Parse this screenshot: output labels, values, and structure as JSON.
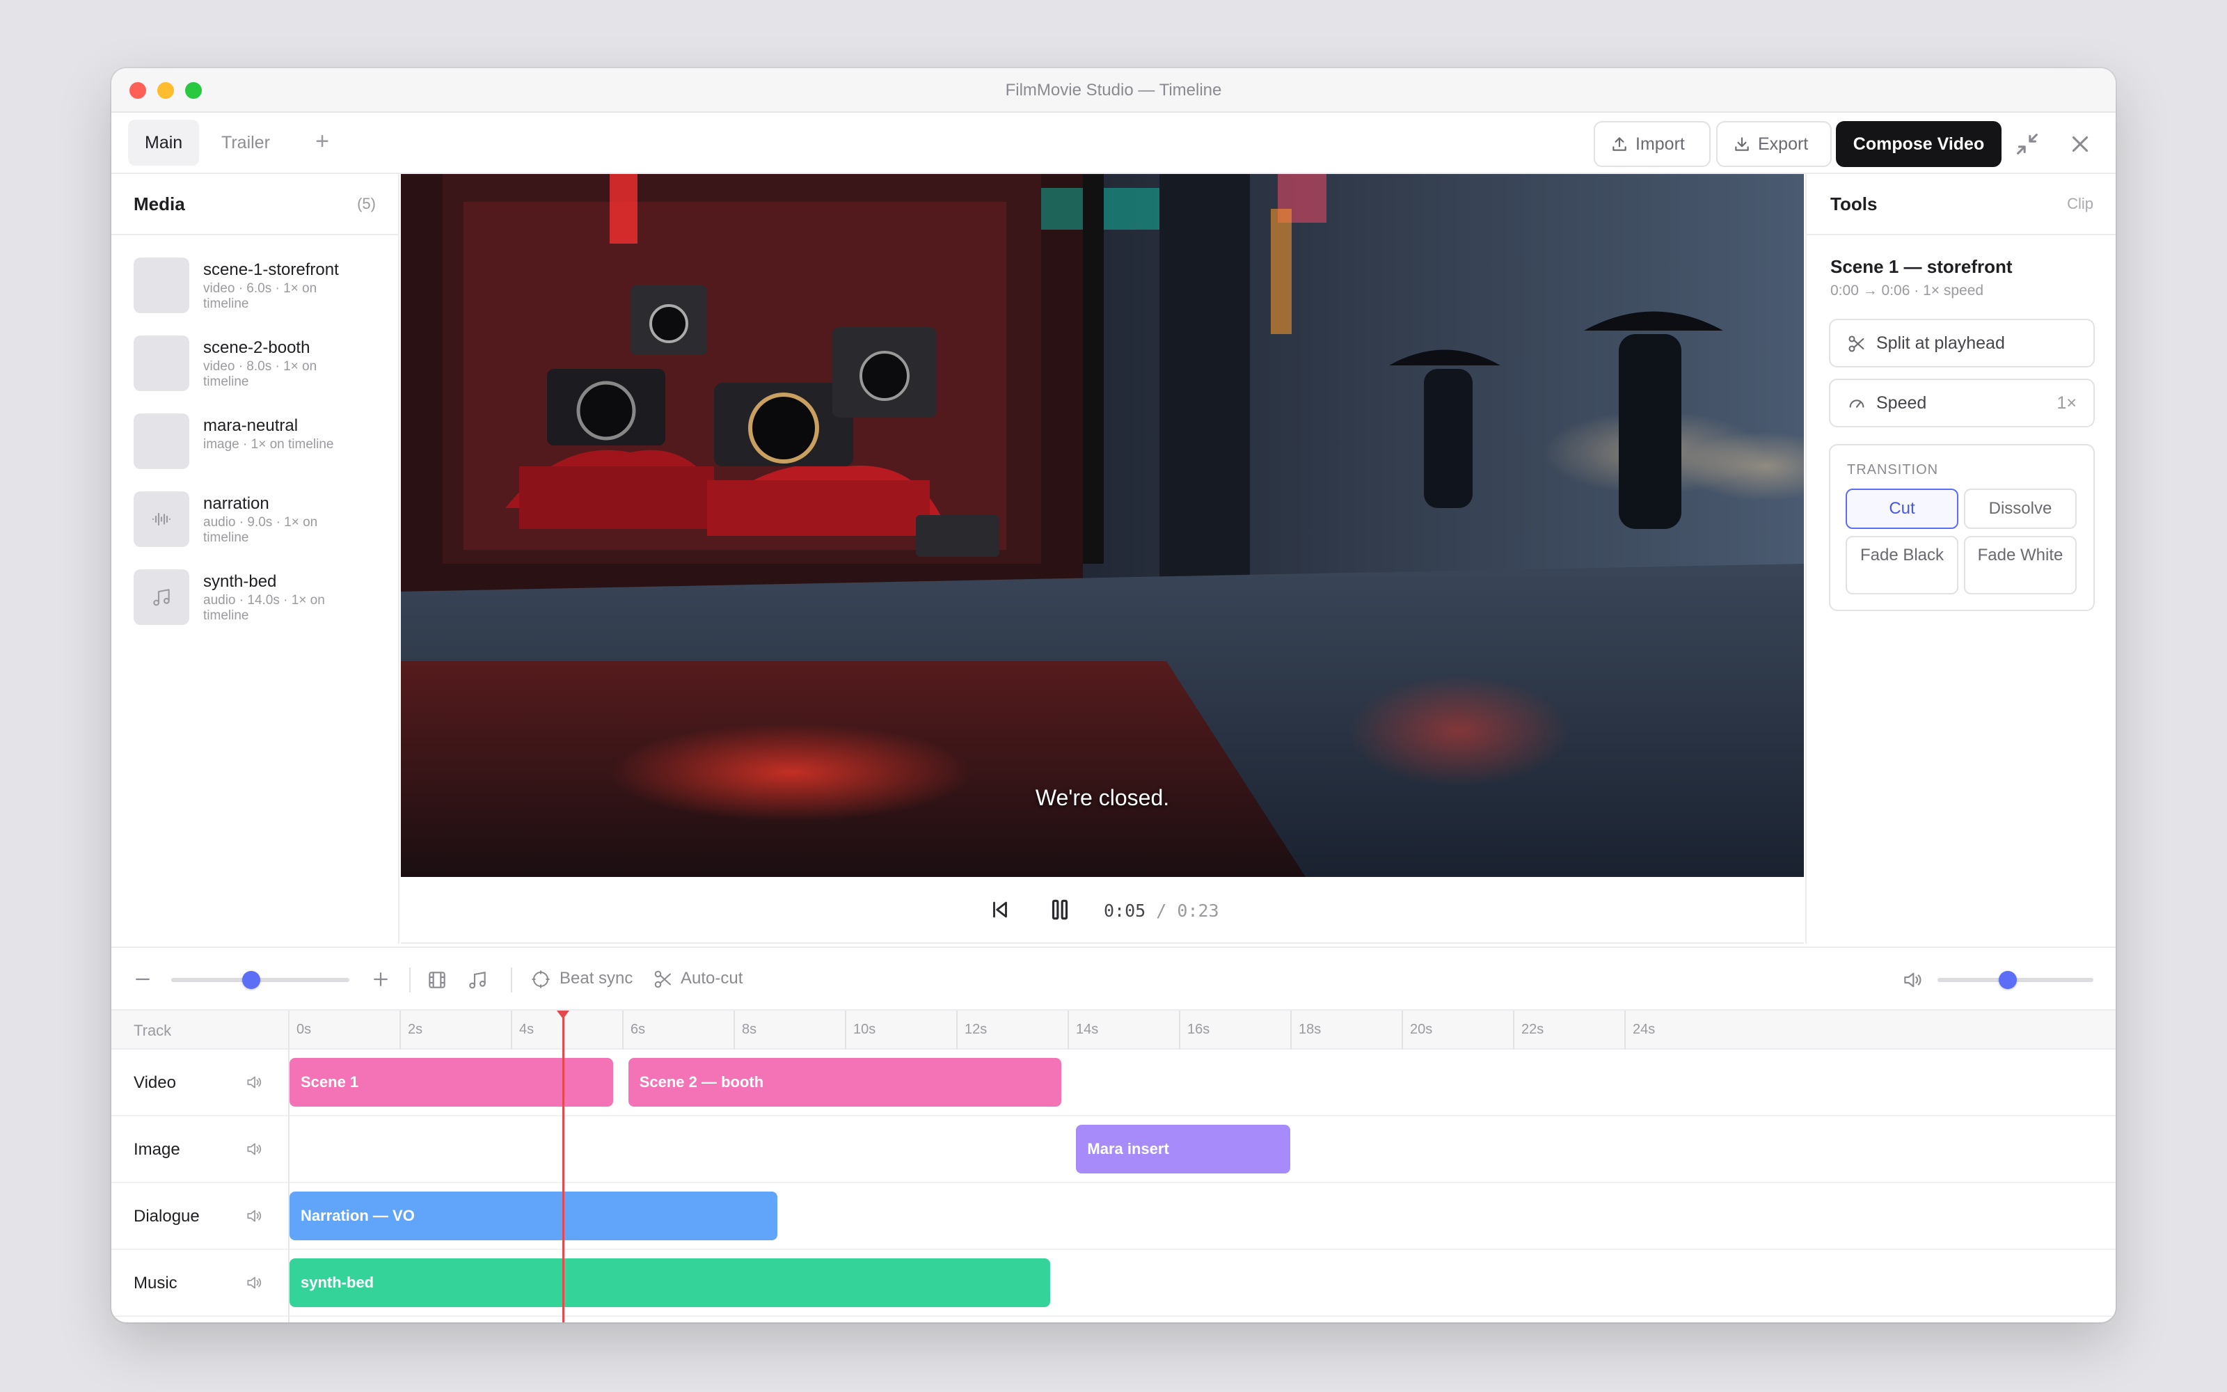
{
  "window": {
    "title": "FilmMovie Studio — Timeline"
  },
  "tabs": [
    {
      "label": "Main",
      "active": true
    },
    {
      "label": "Trailer",
      "active": false
    }
  ],
  "tab_add": "+",
  "toolbar": {
    "import_label": "Import",
    "export_label": "Export",
    "compose_label": "Compose Video"
  },
  "media": {
    "title": "Media",
    "count": "(5)",
    "items": [
      {
        "name": "scene-1-storefront",
        "meta": "video · 6.0s · 1× on timeline",
        "icon": "image-thumb"
      },
      {
        "name": "scene-2-booth",
        "meta": "video · 8.0s · 1× on timeline",
        "icon": "image-thumb"
      },
      {
        "name": "mara-neutral",
        "meta": "image · 1× on timeline",
        "icon": "image-thumb"
      },
      {
        "name": "narration",
        "meta": "audio · 9.0s · 1× on timeline",
        "icon": "waveform-icon"
      },
      {
        "name": "synth-bed",
        "meta": "audio · 14.0s · 1× on timeline",
        "icon": "music-note-icon"
      }
    ]
  },
  "preview": {
    "subtitle": "We're closed.",
    "current_time": "0:05",
    "separator": "/",
    "duration": "0:23"
  },
  "tools": {
    "title": "Tools",
    "context": "Clip",
    "clip_name": "Scene 1 — storefront",
    "clip_meta": "0:00 → 0:06 · 1× speed",
    "split_label": "Split at playhead",
    "speed_label": "Speed",
    "speed_value": "1×",
    "transition": {
      "label": "TRANSITION",
      "options": [
        {
          "label": "Cut",
          "selected": true
        },
        {
          "label": "Dissolve",
          "selected": false
        },
        {
          "label": "Fade Black",
          "selected": false
        },
        {
          "label": "Fade White",
          "selected": false
        }
      ]
    }
  },
  "timeline_toolbar": {
    "zoom_level": 0.45,
    "beat_sync_label": "Beat sync",
    "auto_cut_label": "Auto-cut",
    "volume_level": 0.45
  },
  "timeline": {
    "header_label": "Track",
    "ticks": [
      "0s",
      "2s",
      "4s",
      "6s",
      "8s",
      "10s",
      "12s",
      "14s",
      "16s",
      "18s",
      "20s",
      "22s",
      "24s"
    ],
    "playhead_seconds": 5,
    "tracks": [
      {
        "name": "Video",
        "clips": [
          {
            "label": "Scene 1",
            "start": 0,
            "end": 6,
            "color": "#f472b6"
          },
          {
            "label": "Scene 2 — booth",
            "start": 6.2,
            "end": 14.2,
            "color": "#f472b6"
          }
        ]
      },
      {
        "name": "Image",
        "clips": [
          {
            "label": "Mara insert",
            "start": 14.4,
            "end": 18.4,
            "color": "#a78bfa"
          }
        ]
      },
      {
        "name": "Dialogue",
        "clips": [
          {
            "label": "Narration — VO",
            "start": 0,
            "end": 9,
            "color": "#60a5fa"
          }
        ]
      },
      {
        "name": "Music",
        "clips": [
          {
            "label": "synth-bed",
            "start": 0,
            "end": 14,
            "color": "#34d399"
          }
        ]
      }
    ]
  },
  "colors": {
    "accent": "#5b6ef5",
    "playhead": "#e5484d",
    "compose_bg": "#141416"
  }
}
